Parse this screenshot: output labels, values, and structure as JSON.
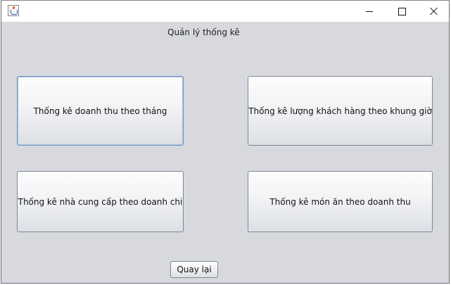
{
  "window": {
    "controls": {
      "minimize_icon": "minimize-icon",
      "maximize_icon": "maximize-icon",
      "close_icon": "close-icon"
    }
  },
  "main": {
    "heading": "Quản lý thống kê",
    "buttons": {
      "revenue_by_month": "Thống kê doanh thu theo tháng",
      "customers_by_timeslot": "Thống kê lượng khách hàng theo khung giờ",
      "suppliers_by_expense": "Thống kê nhà cung cấp theo doanh chi",
      "dishes_by_revenue": "Thống kê món ăn theo doanh thu"
    },
    "back_label": "Quay lại"
  },
  "colors": {
    "panel_background": "#d7d9df",
    "focus_border": "#6f94c0"
  }
}
